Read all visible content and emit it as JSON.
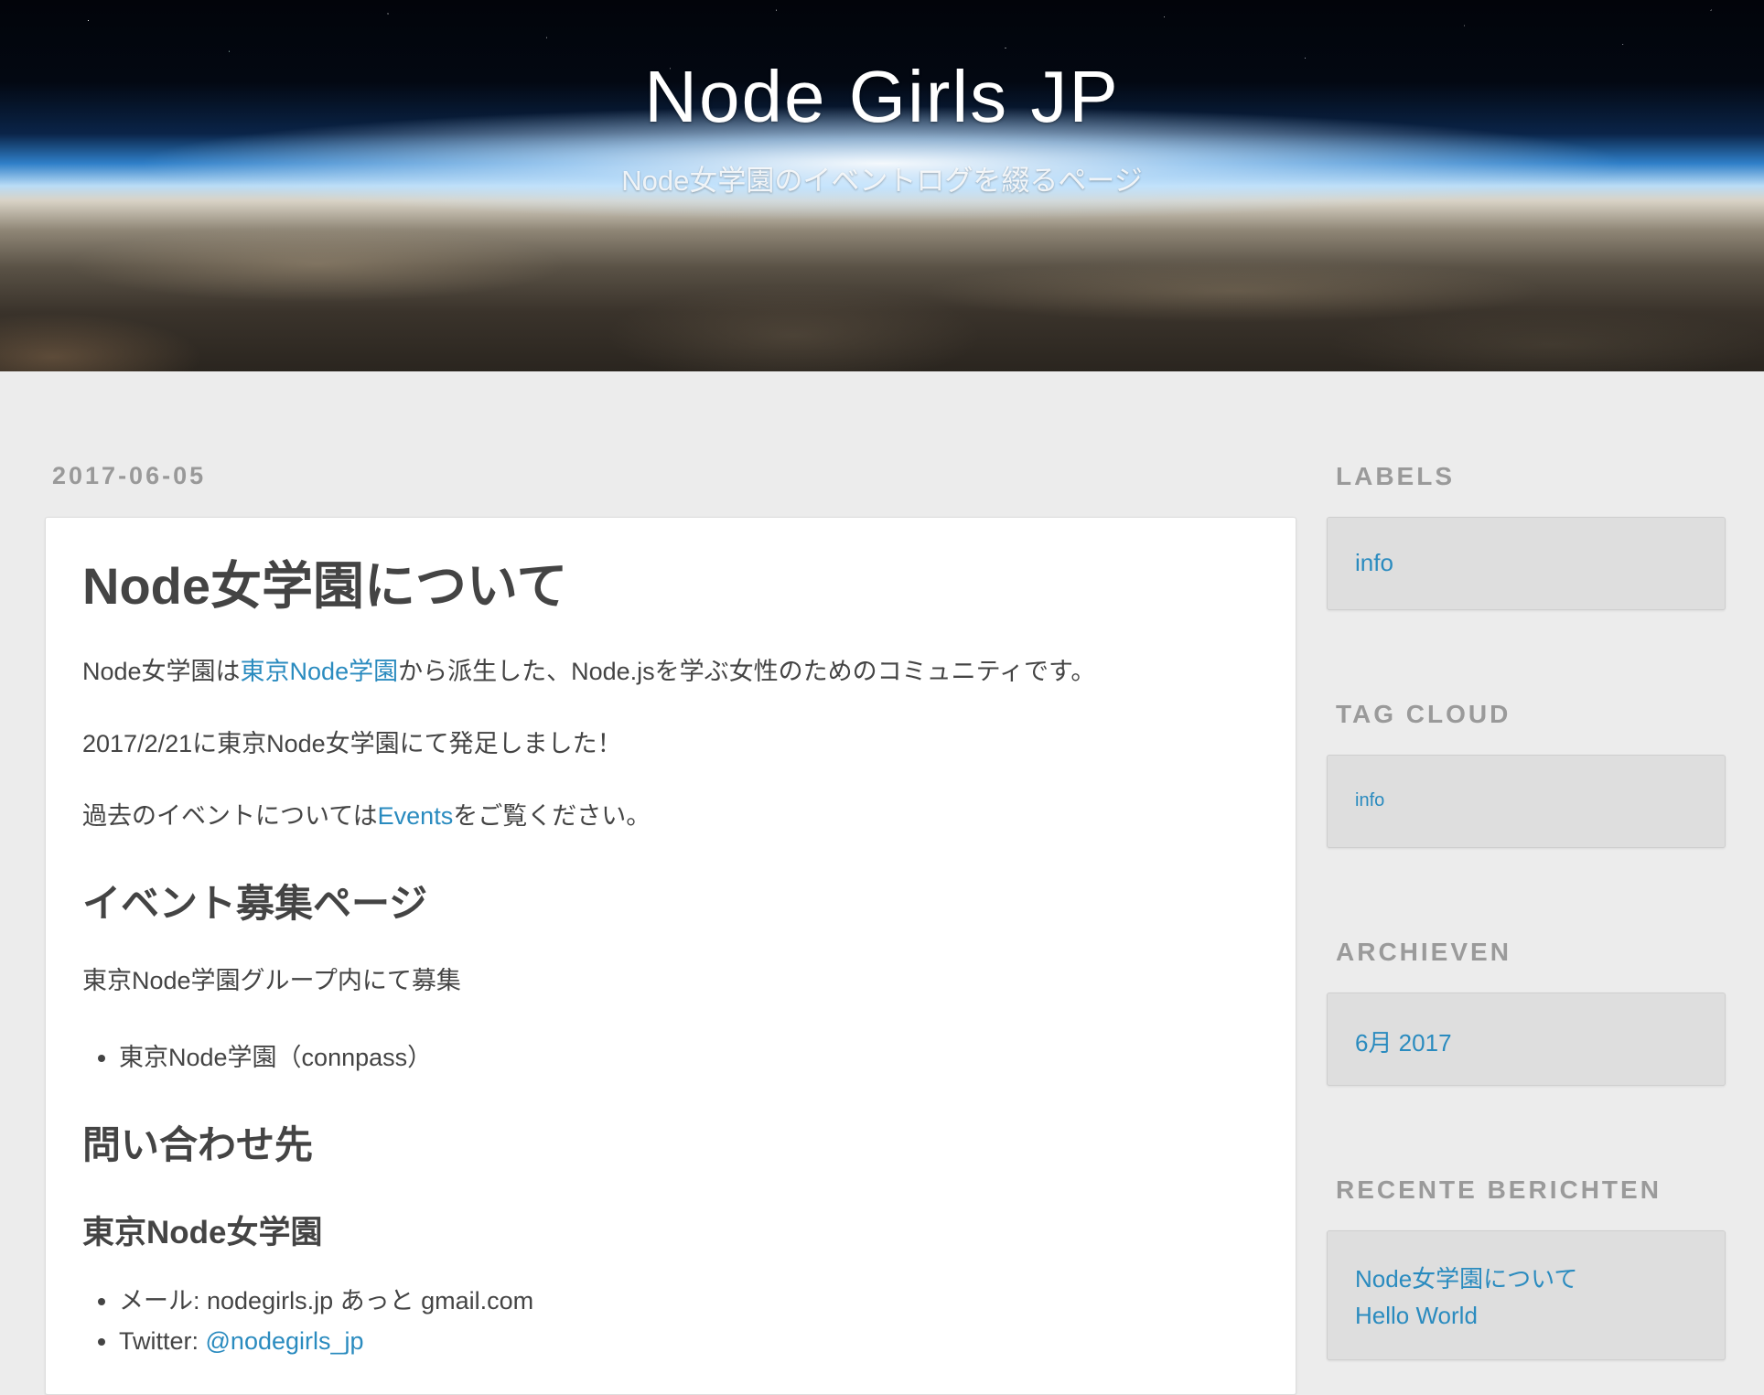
{
  "header": {
    "title": "Node Girls JP",
    "tagline": "Node女学園のイベントログを綴るページ"
  },
  "post": {
    "date": "2017-06-05",
    "title": "Node女学園について",
    "intro": {
      "before": "Node女学園は",
      "link": "東京Node学園",
      "after": "から派生した、Node.jsを学ぶ女性のためのコミュニティです。"
    },
    "founded": "2017/2/21に東京Node女学園にて発足しました！",
    "events_line": {
      "before": "過去のイベントについては",
      "link": "Events",
      "after": "をご覧ください。"
    },
    "recruit_heading": "イベント募集ページ",
    "recruit_text": "東京Node学園グループ内にて募集",
    "recruit_items": [
      "東京Node学園（connpass）"
    ],
    "contact_heading": "問い合わせ先",
    "contact_subheading": "東京Node女学園",
    "contact_mail": "メール: nodegirls.jp あっと gmail.com",
    "contact_twitter_label": "Twitter: ",
    "contact_twitter_link": "@nodegirls_jp"
  },
  "sidebar": {
    "labels": {
      "title": "LABELS",
      "items": [
        "info"
      ]
    },
    "tag_cloud": {
      "title": "TAG CLOUD",
      "items": [
        "info"
      ]
    },
    "archives": {
      "title": "ARCHIEVEN",
      "items": [
        "6月 2017"
      ]
    },
    "recent": {
      "title": "RECENTE BERICHTEN",
      "items": [
        "Node女学園について",
        "Hello World"
      ]
    }
  }
}
